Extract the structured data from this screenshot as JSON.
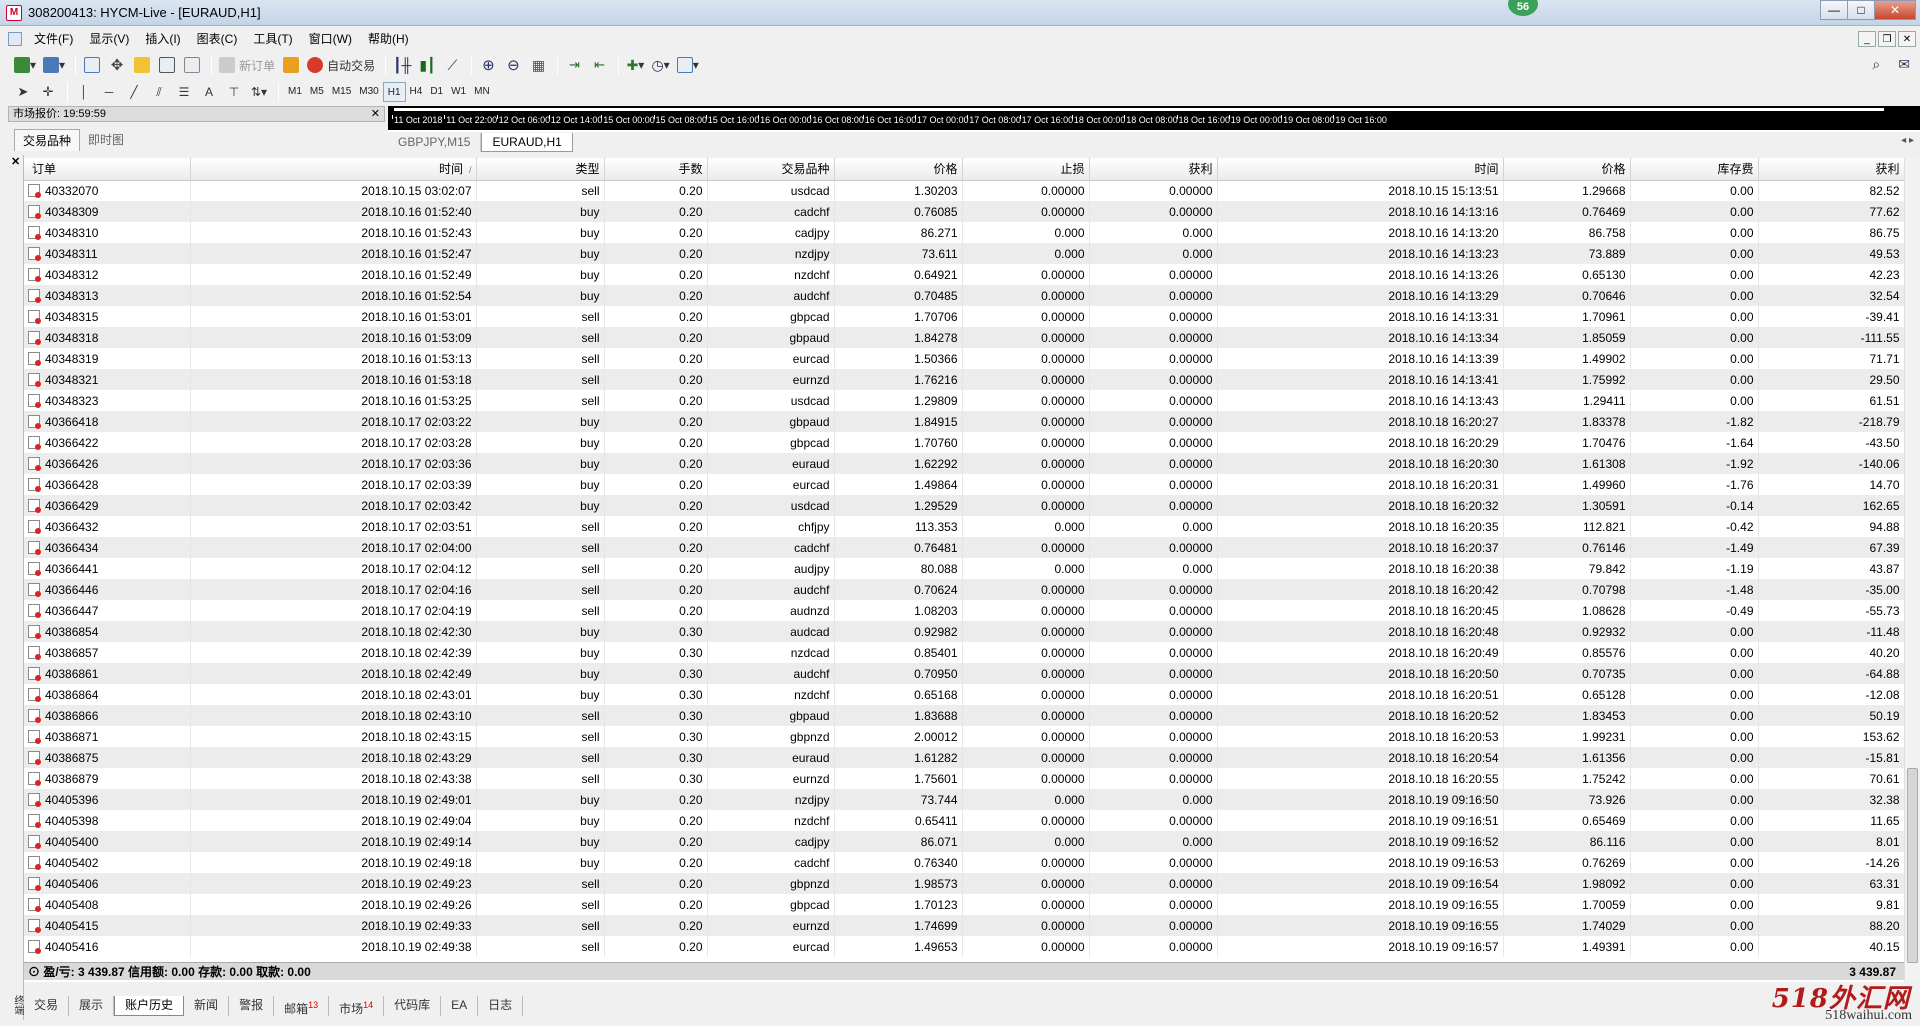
{
  "window": {
    "title": "308200413: HYCM-Live - [EURAUD,H1]",
    "badge": "56",
    "controls": [
      "—",
      "□",
      "✕"
    ]
  },
  "menu": [
    "文件(F)",
    "显示(V)",
    "插入(I)",
    "图表(C)",
    "工具(T)",
    "窗口(W)",
    "帮助(H)"
  ],
  "toolbar": {
    "new_order": "新订单",
    "auto_trading": "自动交易",
    "timeframes": [
      "M1",
      "M5",
      "M15",
      "M30",
      "H1",
      "H4",
      "D1",
      "W1",
      "MN"
    ],
    "active_timeframe": "H1"
  },
  "market_watch": {
    "header": "市场报价: 19:59:59",
    "tabs": [
      "交易品种",
      "即时图"
    ]
  },
  "chart": {
    "ticks": [
      "11 Oct 2018",
      "11 Oct 22:00",
      "12 Oct 06:00",
      "12 Oct 14:00",
      "15 Oct 00:00",
      "15 Oct 08:00",
      "15 Oct 16:00",
      "16 Oct 00:00",
      "16 Oct 08:00",
      "16 Oct 16:00",
      "17 Oct 00:00",
      "17 Oct 08:00",
      "17 Oct 16:00",
      "18 Oct 00:00",
      "18 Oct 08:00",
      "18 Oct 16:00",
      "19 Oct 00:00",
      "19 Oct 08:00",
      "19 Oct 16:00"
    ],
    "tabs": [
      "GBPJPY,M15",
      "EURAUD,H1"
    ],
    "active_tab": "EURAUD,H1"
  },
  "terminal": {
    "side_label": "终端",
    "columns": [
      "订单",
      "时间",
      "类型",
      "手数",
      "交易品种",
      "价格",
      "止损",
      "获利",
      "时间",
      "价格",
      "库存费",
      "获利"
    ],
    "rows": [
      [
        "40332070",
        "2018.10.15 03:02:07",
        "sell",
        "0.20",
        "usdcad",
        "1.30203",
        "0.00000",
        "0.00000",
        "2018.10.15 15:13:51",
        "1.29668",
        "0.00",
        "82.52"
      ],
      [
        "40348309",
        "2018.10.16 01:52:40",
        "buy",
        "0.20",
        "cadchf",
        "0.76085",
        "0.00000",
        "0.00000",
        "2018.10.16 14:13:16",
        "0.76469",
        "0.00",
        "77.62"
      ],
      [
        "40348310",
        "2018.10.16 01:52:43",
        "buy",
        "0.20",
        "cadjpy",
        "86.271",
        "0.000",
        "0.000",
        "2018.10.16 14:13:20",
        "86.758",
        "0.00",
        "86.75"
      ],
      [
        "40348311",
        "2018.10.16 01:52:47",
        "buy",
        "0.20",
        "nzdjpy",
        "73.611",
        "0.000",
        "0.000",
        "2018.10.16 14:13:23",
        "73.889",
        "0.00",
        "49.53"
      ],
      [
        "40348312",
        "2018.10.16 01:52:49",
        "buy",
        "0.20",
        "nzdchf",
        "0.64921",
        "0.00000",
        "0.00000",
        "2018.10.16 14:13:26",
        "0.65130",
        "0.00",
        "42.23"
      ],
      [
        "40348313",
        "2018.10.16 01:52:54",
        "buy",
        "0.20",
        "audchf",
        "0.70485",
        "0.00000",
        "0.00000",
        "2018.10.16 14:13:29",
        "0.70646",
        "0.00",
        "32.54"
      ],
      [
        "40348315",
        "2018.10.16 01:53:01",
        "sell",
        "0.20",
        "gbpcad",
        "1.70706",
        "0.00000",
        "0.00000",
        "2018.10.16 14:13:31",
        "1.70961",
        "0.00",
        "-39.41"
      ],
      [
        "40348318",
        "2018.10.16 01:53:09",
        "sell",
        "0.20",
        "gbpaud",
        "1.84278",
        "0.00000",
        "0.00000",
        "2018.10.16 14:13:34",
        "1.85059",
        "0.00",
        "-111.55"
      ],
      [
        "40348319",
        "2018.10.16 01:53:13",
        "sell",
        "0.20",
        "eurcad",
        "1.50366",
        "0.00000",
        "0.00000",
        "2018.10.16 14:13:39",
        "1.49902",
        "0.00",
        "71.71"
      ],
      [
        "40348321",
        "2018.10.16 01:53:18",
        "sell",
        "0.20",
        "eurnzd",
        "1.76216",
        "0.00000",
        "0.00000",
        "2018.10.16 14:13:41",
        "1.75992",
        "0.00",
        "29.50"
      ],
      [
        "40348323",
        "2018.10.16 01:53:25",
        "sell",
        "0.20",
        "usdcad",
        "1.29809",
        "0.00000",
        "0.00000",
        "2018.10.16 14:13:43",
        "1.29411",
        "0.00",
        "61.51"
      ],
      [
        "40366418",
        "2018.10.17 02:03:22",
        "buy",
        "0.20",
        "gbpaud",
        "1.84915",
        "0.00000",
        "0.00000",
        "2018.10.18 16:20:27",
        "1.83378",
        "-1.82",
        "-218.79"
      ],
      [
        "40366422",
        "2018.10.17 02:03:28",
        "buy",
        "0.20",
        "gbpcad",
        "1.70760",
        "0.00000",
        "0.00000",
        "2018.10.18 16:20:29",
        "1.70476",
        "-1.64",
        "-43.50"
      ],
      [
        "40366426",
        "2018.10.17 02:03:36",
        "buy",
        "0.20",
        "euraud",
        "1.62292",
        "0.00000",
        "0.00000",
        "2018.10.18 16:20:30",
        "1.61308",
        "-1.92",
        "-140.06"
      ],
      [
        "40366428",
        "2018.10.17 02:03:39",
        "buy",
        "0.20",
        "eurcad",
        "1.49864",
        "0.00000",
        "0.00000",
        "2018.10.18 16:20:31",
        "1.49960",
        "-1.76",
        "14.70"
      ],
      [
        "40366429",
        "2018.10.17 02:03:42",
        "buy",
        "0.20",
        "usdcad",
        "1.29529",
        "0.00000",
        "0.00000",
        "2018.10.18 16:20:32",
        "1.30591",
        "-0.14",
        "162.65"
      ],
      [
        "40366432",
        "2018.10.17 02:03:51",
        "sell",
        "0.20",
        "chfjpy",
        "113.353",
        "0.000",
        "0.000",
        "2018.10.18 16:20:35",
        "112.821",
        "-0.42",
        "94.88"
      ],
      [
        "40366434",
        "2018.10.17 02:04:00",
        "sell",
        "0.20",
        "cadchf",
        "0.76481",
        "0.00000",
        "0.00000",
        "2018.10.18 16:20:37",
        "0.76146",
        "-1.49",
        "67.39"
      ],
      [
        "40366441",
        "2018.10.17 02:04:12",
        "sell",
        "0.20",
        "audjpy",
        "80.088",
        "0.000",
        "0.000",
        "2018.10.18 16:20:38",
        "79.842",
        "-1.19",
        "43.87"
      ],
      [
        "40366446",
        "2018.10.17 02:04:16",
        "sell",
        "0.20",
        "audchf",
        "0.70624",
        "0.00000",
        "0.00000",
        "2018.10.18 16:20:42",
        "0.70798",
        "-1.48",
        "-35.00"
      ],
      [
        "40366447",
        "2018.10.17 02:04:19",
        "sell",
        "0.20",
        "audnzd",
        "1.08203",
        "0.00000",
        "0.00000",
        "2018.10.18 16:20:45",
        "1.08628",
        "-0.49",
        "-55.73"
      ],
      [
        "40386854",
        "2018.10.18 02:42:30",
        "buy",
        "0.30",
        "audcad",
        "0.92982",
        "0.00000",
        "0.00000",
        "2018.10.18 16:20:48",
        "0.92932",
        "0.00",
        "-11.48"
      ],
      [
        "40386857",
        "2018.10.18 02:42:39",
        "buy",
        "0.30",
        "nzdcad",
        "0.85401",
        "0.00000",
        "0.00000",
        "2018.10.18 16:20:49",
        "0.85576",
        "0.00",
        "40.20"
      ],
      [
        "40386861",
        "2018.10.18 02:42:49",
        "buy",
        "0.30",
        "audchf",
        "0.70950",
        "0.00000",
        "0.00000",
        "2018.10.18 16:20:50",
        "0.70735",
        "0.00",
        "-64.88"
      ],
      [
        "40386864",
        "2018.10.18 02:43:01",
        "buy",
        "0.30",
        "nzdchf",
        "0.65168",
        "0.00000",
        "0.00000",
        "2018.10.18 16:20:51",
        "0.65128",
        "0.00",
        "-12.08"
      ],
      [
        "40386866",
        "2018.10.18 02:43:10",
        "sell",
        "0.30",
        "gbpaud",
        "1.83688",
        "0.00000",
        "0.00000",
        "2018.10.18 16:20:52",
        "1.83453",
        "0.00",
        "50.19"
      ],
      [
        "40386871",
        "2018.10.18 02:43:15",
        "sell",
        "0.30",
        "gbpnzd",
        "2.00012",
        "0.00000",
        "0.00000",
        "2018.10.18 16:20:53",
        "1.99231",
        "0.00",
        "153.62"
      ],
      [
        "40386875",
        "2018.10.18 02:43:29",
        "sell",
        "0.30",
        "euraud",
        "1.61282",
        "0.00000",
        "0.00000",
        "2018.10.18 16:20:54",
        "1.61356",
        "0.00",
        "-15.81"
      ],
      [
        "40386879",
        "2018.10.18 02:43:38",
        "sell",
        "0.30",
        "eurnzd",
        "1.75601",
        "0.00000",
        "0.00000",
        "2018.10.18 16:20:55",
        "1.75242",
        "0.00",
        "70.61"
      ],
      [
        "40405396",
        "2018.10.19 02:49:01",
        "buy",
        "0.20",
        "nzdjpy",
        "73.744",
        "0.000",
        "0.000",
        "2018.10.19 09:16:50",
        "73.926",
        "0.00",
        "32.38"
      ],
      [
        "40405398",
        "2018.10.19 02:49:04",
        "buy",
        "0.20",
        "nzdchf",
        "0.65411",
        "0.00000",
        "0.00000",
        "2018.10.19 09:16:51",
        "0.65469",
        "0.00",
        "11.65"
      ],
      [
        "40405400",
        "2018.10.19 02:49:14",
        "buy",
        "0.20",
        "cadjpy",
        "86.071",
        "0.000",
        "0.000",
        "2018.10.19 09:16:52",
        "86.116",
        "0.00",
        "8.01"
      ],
      [
        "40405402",
        "2018.10.19 02:49:18",
        "buy",
        "0.20",
        "cadchf",
        "0.76340",
        "0.00000",
        "0.00000",
        "2018.10.19 09:16:53",
        "0.76269",
        "0.00",
        "-14.26"
      ],
      [
        "40405406",
        "2018.10.19 02:49:23",
        "sell",
        "0.20",
        "gbpnzd",
        "1.98573",
        "0.00000",
        "0.00000",
        "2018.10.19 09:16:54",
        "1.98092",
        "0.00",
        "63.31"
      ],
      [
        "40405408",
        "2018.10.19 02:49:26",
        "sell",
        "0.20",
        "gbpcad",
        "1.70123",
        "0.00000",
        "0.00000",
        "2018.10.19 09:16:55",
        "1.70059",
        "0.00",
        "9.81"
      ],
      [
        "40405415",
        "2018.10.19 02:49:33",
        "sell",
        "0.20",
        "eurnzd",
        "1.74699",
        "0.00000",
        "0.00000",
        "2018.10.19 09:16:55",
        "1.74029",
        "0.00",
        "88.20"
      ],
      [
        "40405416",
        "2018.10.19 02:49:38",
        "sell",
        "0.20",
        "eurcad",
        "1.49653",
        "0.00000",
        "0.00000",
        "2018.10.19 09:16:57",
        "1.49391",
        "0.00",
        "40.15"
      ]
    ],
    "summary_left": "盈/亏: 3 439.87  信用额: 0.00  存款: 0.00  取款: 0.00",
    "summary_right": "3 439.87",
    "bottom_tabs": [
      {
        "label": "交易",
        "count": ""
      },
      {
        "label": "展示",
        "count": ""
      },
      {
        "label": "账户历史",
        "count": ""
      },
      {
        "label": "新闻",
        "count": ""
      },
      {
        "label": "警报",
        "count": ""
      },
      {
        "label": "邮箱",
        "count": "13"
      },
      {
        "label": "市场",
        "count": "14"
      },
      {
        "label": "代码库",
        "count": ""
      },
      {
        "label": "EA",
        "count": ""
      },
      {
        "label": "日志",
        "count": ""
      }
    ],
    "active_bottom_tab": "账户历史"
  },
  "watermark": {
    "main": "518外汇网",
    "sub": "518waihui.com"
  }
}
